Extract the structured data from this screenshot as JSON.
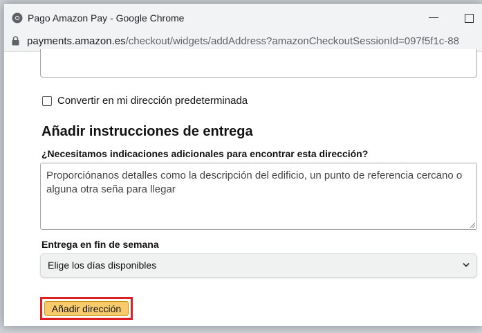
{
  "window": {
    "title": "Pago Amazon Pay - Google Chrome",
    "minimize_glyph": "—",
    "icon": "chrome-icon"
  },
  "address_bar": {
    "host": "payments.amazon.es",
    "path": "/checkout/widgets/addAddress?amazonCheckoutSessionId=097f5f1c-88",
    "icon": "lock-icon"
  },
  "form": {
    "default_address_label": "Convertir en mi dirección predeterminada",
    "default_address_checked": false,
    "section_title": "Añadir instrucciones de entrega",
    "question": "¿Necesitamos indicaciones adicionales para encontrar esta dirección?",
    "instructions_placeholder": "Proporciónanos detalles como la descripción del edificio, un punto de referencia cercano o alguna otra seña  para llegar",
    "weekend_label": "Entrega en fin de semana",
    "weekend_select_value": "Elige los días disponibles",
    "add_button_label": "Añadir dirección"
  },
  "colors": {
    "button_bg": "#f7ca6b",
    "highlight": "#e02020"
  }
}
